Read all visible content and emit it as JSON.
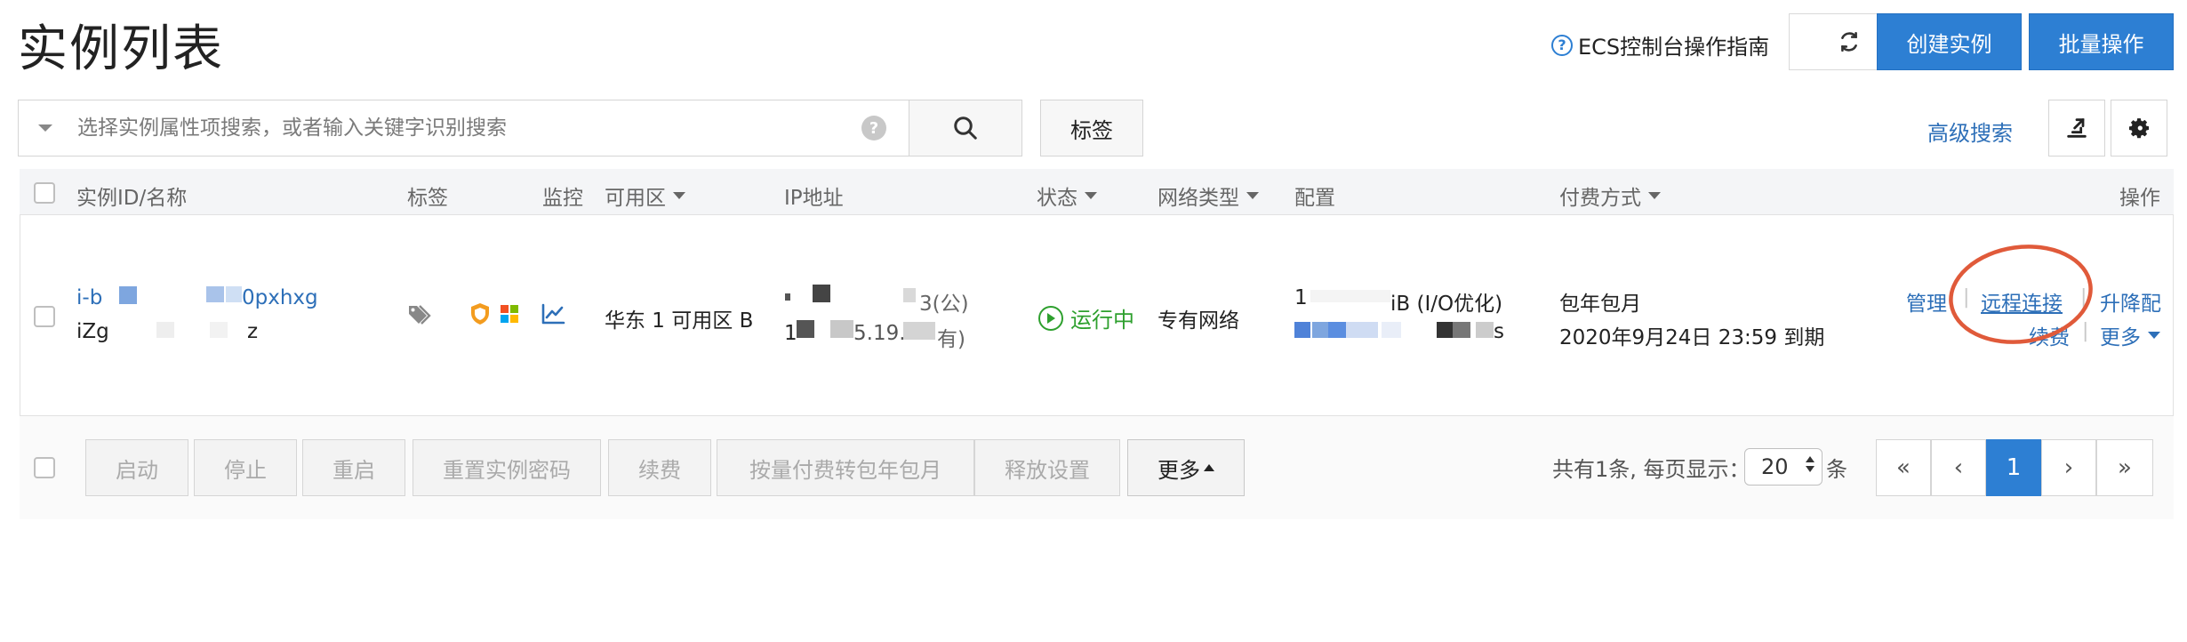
{
  "header": {
    "title": "实例列表",
    "guide_label": "ECS控制台操作指南",
    "guide_icon": "help-circle-icon",
    "refresh_icon": "refresh-icon",
    "create_label": "创建实例",
    "batch_label": "批量操作",
    "accent_color": "#2d7fd3"
  },
  "search": {
    "placeholder": "选择实例属性项搜索，或者输入关键字识别搜索",
    "help_glyph": "?",
    "tag_button_label": "标签",
    "advanced_label": "高级搜索",
    "export_icon": "export-icon",
    "settings_icon": "gear-icon"
  },
  "table": {
    "columns": {
      "id_name": "实例ID/名称",
      "tags": "标签",
      "monitor": "监控",
      "zone": "可用区",
      "ip": "IP地址",
      "status": "状态",
      "network": "网络类型",
      "config": "配置",
      "billing": "付费方式",
      "actions": "操作"
    },
    "row": {
      "id_prefix": "i-b",
      "id_suffix": "0pxhxg",
      "name_prefix": "iZg",
      "name_suffix": "z",
      "zone": "华东 1 可用区 B",
      "ip_public_suffix": "3(公)",
      "ip_private_part": "1",
      "ip_private_mid": "5.19.2",
      "ip_private_suffix": "有)",
      "status": "运行中",
      "network": "专有网络",
      "config_prefix": "1",
      "config_suffix": "iB (I/O优化)",
      "config_line2_suffix": "s",
      "billing_type": "包年包月",
      "expire": "2020年9月24日 23:59 到期",
      "actions": {
        "manage": "管理",
        "remote": "远程连接",
        "upgrade": "升降配",
        "renew": "续费",
        "more": "更多"
      }
    }
  },
  "footer": {
    "buttons": [
      "启动",
      "停止",
      "重启",
      "重置实例密码",
      "续费",
      "按量付费转包年包月",
      "释放设置"
    ],
    "more_label": "更多",
    "total_text": "共有1条, 每页显示：",
    "page_size": "20",
    "unit": "条",
    "pages": {
      "first": "«",
      "prev": "‹",
      "current": "1",
      "next": "›",
      "last": "»"
    }
  },
  "annotation_color": "#e05a3a"
}
